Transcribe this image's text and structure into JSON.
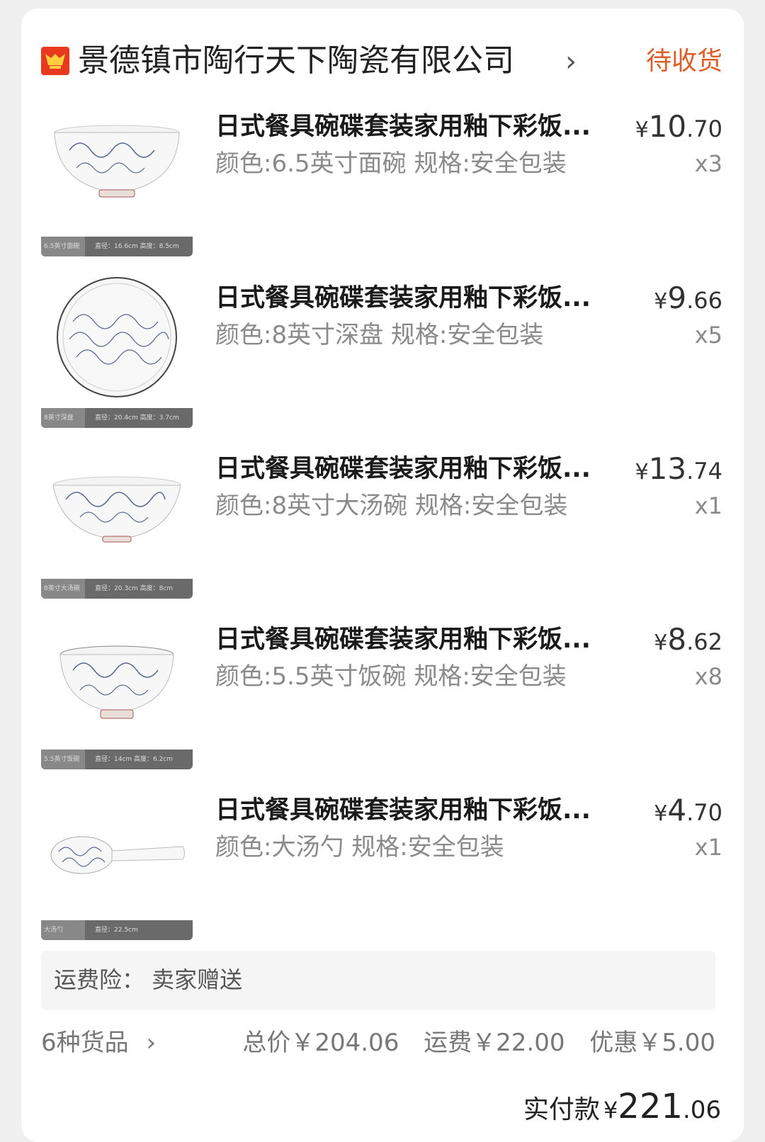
{
  "shop": {
    "name": "景德镇市陶行天下陶瓷有限公司",
    "arrow": "›",
    "status": "待收货"
  },
  "items": [
    {
      "title": "日式餐具碗碟套装家用釉下彩饭...",
      "spec": "颜色:6.5英寸面碗 规格:安全包装",
      "price_currency": "¥",
      "price_int": "10",
      "price_dec": ".70",
      "qty": "x3",
      "thumb_label": "6.5英寸面碗",
      "thumb_dims": "直径：16.6cm  高度：8.5cm",
      "thumb_icon": "bowl-icon"
    },
    {
      "title": "日式餐具碗碟套装家用釉下彩饭...",
      "spec": "颜色:8英寸深盘 规格:安全包装",
      "price_currency": "¥",
      "price_int": "9",
      "price_dec": ".66",
      "qty": "x5",
      "thumb_label": "8英寸深盘",
      "thumb_dims": "直径：20.4cm  高度：3.7cm",
      "thumb_icon": "plate-icon"
    },
    {
      "title": "日式餐具碗碟套装家用釉下彩饭...",
      "spec": "颜色:8英寸大汤碗 规格:安全包装",
      "price_currency": "¥",
      "price_int": "13",
      "price_dec": ".74",
      "qty": "x1",
      "thumb_label": "8英寸大汤碗",
      "thumb_dims": "直径：20.3cm  高度：8cm",
      "thumb_icon": "soup-bowl-icon"
    },
    {
      "title": "日式餐具碗碟套装家用釉下彩饭...",
      "spec": "颜色:5.5英寸饭碗 规格:安全包装",
      "price_currency": "¥",
      "price_int": "8",
      "price_dec": ".62",
      "qty": "x8",
      "thumb_label": "5.5英寸饭碗",
      "thumb_dims": "直径：14cm  高度：6.2cm",
      "thumb_icon": "rice-bowl-icon"
    },
    {
      "title": "日式餐具碗碟套装家用釉下彩饭...",
      "spec": "颜色:大汤勺 规格:安全包装",
      "price_currency": "¥",
      "price_int": "4",
      "price_dec": ".70",
      "qty": "x1",
      "thumb_label": "大汤勺",
      "thumb_dims": "直径：22.5cm",
      "thumb_icon": "spoon-icon"
    }
  ],
  "insurance": {
    "text": "运费险：  卖家赠送"
  },
  "summary": {
    "goods_count": "6种货品",
    "goods_arrow": "›",
    "total": "总价￥204.06",
    "shipping": "运费￥22.00",
    "discount": "优惠￥5.00"
  },
  "paid": {
    "label": "实付款",
    "currency": "¥",
    "int": "221",
    "dec": ".06"
  },
  "colors": {
    "status": "#e05d2a",
    "logo": "#e8391f",
    "pattern": "#5b6a8a"
  }
}
